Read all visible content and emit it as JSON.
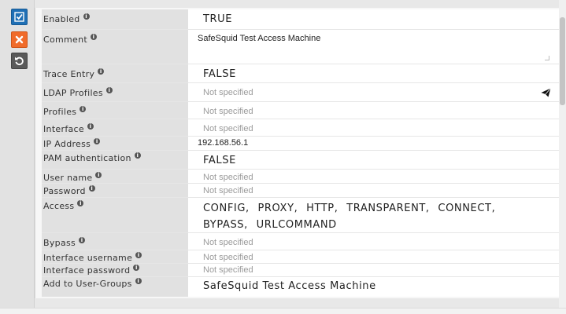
{
  "actions": {
    "save": "save-icon",
    "cancel": "close-icon",
    "reset": "undo-icon"
  },
  "colors": {
    "save_button": "#1f6fb5",
    "cancel_button": "#f06b2a",
    "reset_button": "#5a5a5a"
  },
  "fields": {
    "enabled": {
      "label": "Enabled",
      "value": "TRUE"
    },
    "comment": {
      "label": "Comment",
      "value": "SafeSquid Test Access Machine"
    },
    "trace_entry": {
      "label": "Trace Entry",
      "value": "FALSE"
    },
    "ldap_profiles": {
      "label": "LDAP Profiles",
      "placeholder": "Not specified"
    },
    "profiles": {
      "label": "Profiles",
      "placeholder": "Not specified"
    },
    "interface": {
      "label": "Interface",
      "placeholder": "Not specified"
    },
    "ip_address": {
      "label": "IP Address",
      "value": "192.168.56.1"
    },
    "pam_authentication": {
      "label": "PAM authentication",
      "value": "FALSE"
    },
    "user_name": {
      "label": "User name",
      "placeholder": "Not specified"
    },
    "password": {
      "label": "Password",
      "placeholder": "Not specified"
    },
    "access": {
      "label": "Access",
      "value": "CONFIG, PROXY, HTTP, TRANSPARENT, CONNECT, BYPASS, URLCOMMAND"
    },
    "bypass": {
      "label": "Bypass",
      "placeholder": "Not specified"
    },
    "interface_username": {
      "label": "Interface username",
      "placeholder": "Not specified"
    },
    "interface_password": {
      "label": "Interface password",
      "placeholder": "Not specified"
    },
    "add_to_user_groups": {
      "label": "Add to User-Groups",
      "value": "SafeSquid Test Access Machine"
    }
  },
  "info_glyph": "i"
}
